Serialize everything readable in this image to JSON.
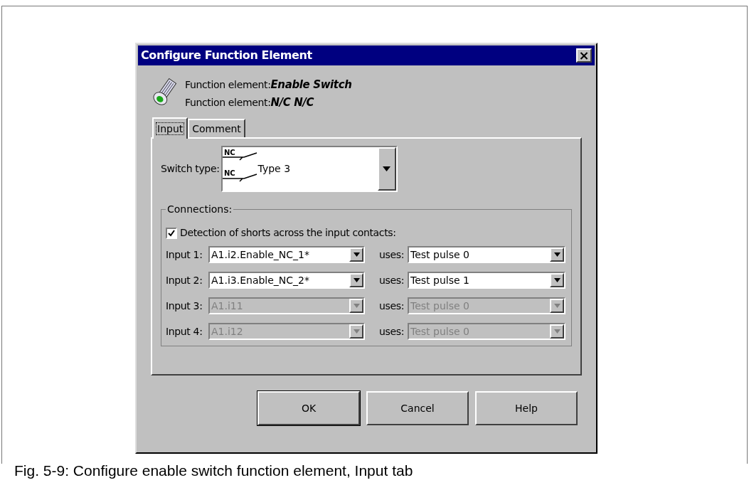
{
  "dialog": {
    "title": "Configure Function Element",
    "close": "×",
    "info": [
      {
        "label": "Function element:",
        "value": "Enable Switch"
      },
      {
        "label": "Function element:",
        "value": "N/C N/C"
      }
    ],
    "tabs": [
      {
        "label": "Input",
        "selected": true
      },
      {
        "label": "Comment",
        "selected": false
      }
    ],
    "switch_type": {
      "label": "Switch type:",
      "symbol_labels": [
        "NC",
        "NC"
      ],
      "value": "Type 3"
    },
    "connections": {
      "title": "Connections:",
      "detection": {
        "label": "Detection of shorts across the input contacts:",
        "checked": true
      },
      "rows": [
        {
          "label": "Input 1:",
          "value": "A1.i2.Enable_NC_1*",
          "uses_label": "uses:",
          "uses_value": "Test pulse 0",
          "disabled": false
        },
        {
          "label": "Input 2:",
          "value": "A1.i3.Enable_NC_2*",
          "uses_label": "uses:",
          "uses_value": "Test pulse 1",
          "disabled": false
        },
        {
          "label": "Input 3:",
          "value": "A1.i11",
          "uses_label": "uses:",
          "uses_value": "Test pulse 0",
          "disabled": true
        },
        {
          "label": "Input 4:",
          "value": "A1.i12",
          "uses_label": "uses:",
          "uses_value": "Test pulse 0",
          "disabled": true
        }
      ]
    },
    "buttons": [
      {
        "label": "OK",
        "default": true
      },
      {
        "label": "Cancel",
        "default": false
      },
      {
        "label": "Help",
        "default": false
      }
    ]
  },
  "caption": "Fig. 5-9: Configure enable switch function element, Input tab"
}
